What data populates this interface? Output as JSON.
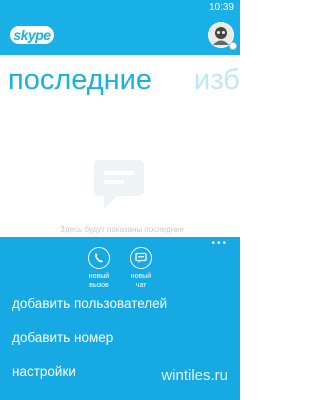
{
  "status_bar": {
    "time": "10:39"
  },
  "header": {
    "logo_text": "skype",
    "accent": "#19b0e8"
  },
  "pivot": {
    "active": "последние",
    "next": "избранное"
  },
  "main": {
    "empty_message": "Здесь будут показаны последние"
  },
  "app_bar": {
    "background": "#17a9e3",
    "buttons": [
      {
        "label": "новый\nвызов",
        "icon": "phone-icon"
      },
      {
        "label": "новый\nчат",
        "icon": "chat-icon"
      }
    ],
    "menu_items": [
      "добавить пользователей",
      "добавить номер",
      "настройки"
    ]
  },
  "watermark": "wintiles.ru"
}
